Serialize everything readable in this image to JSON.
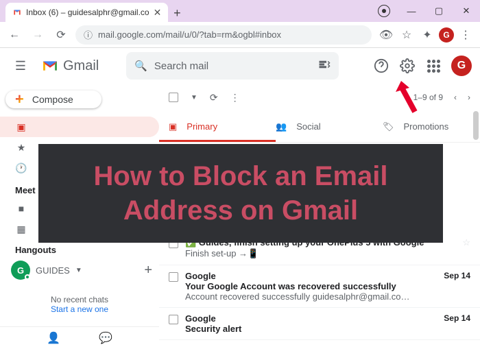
{
  "browser": {
    "tab_title": "Inbox (6) – guidesalphr@gmail.co",
    "url": "mail.google.com/mail/u/0/?tab=rm&ogbl#inbox"
  },
  "gmail": {
    "brand": "Gmail",
    "search_placeholder": "Search mail",
    "compose": "Compose",
    "meet_header": "Meet",
    "hangouts_header": "Hangouts",
    "hangouts_user": "GUIDES",
    "hangouts_initial": "G",
    "no_chats_line1": "No recent chats",
    "no_chats_line2": "Start a new one",
    "avatar_initial": "G",
    "pager": "1–9 of 9"
  },
  "tabs": {
    "primary": "Primary",
    "social": "Social",
    "promotions": "Promotions"
  },
  "emails": [
    {
      "sender": "",
      "subject": "✅ Guides, finish setting up your OnePlus 5 with Google",
      "snippet": "Finish set-up →📱",
      "date": ""
    },
    {
      "sender": "Google",
      "subject": "Your Google Account was recovered successfully",
      "snippet": "Account recovered successfully guidesalphr@gmail.co…",
      "date": "Sep 14"
    },
    {
      "sender": "Google",
      "subject": "Security alert",
      "snippet": "",
      "date": "Sep 14"
    }
  ],
  "banner": {
    "text": "How to Block an Email Address on Gmail"
  }
}
